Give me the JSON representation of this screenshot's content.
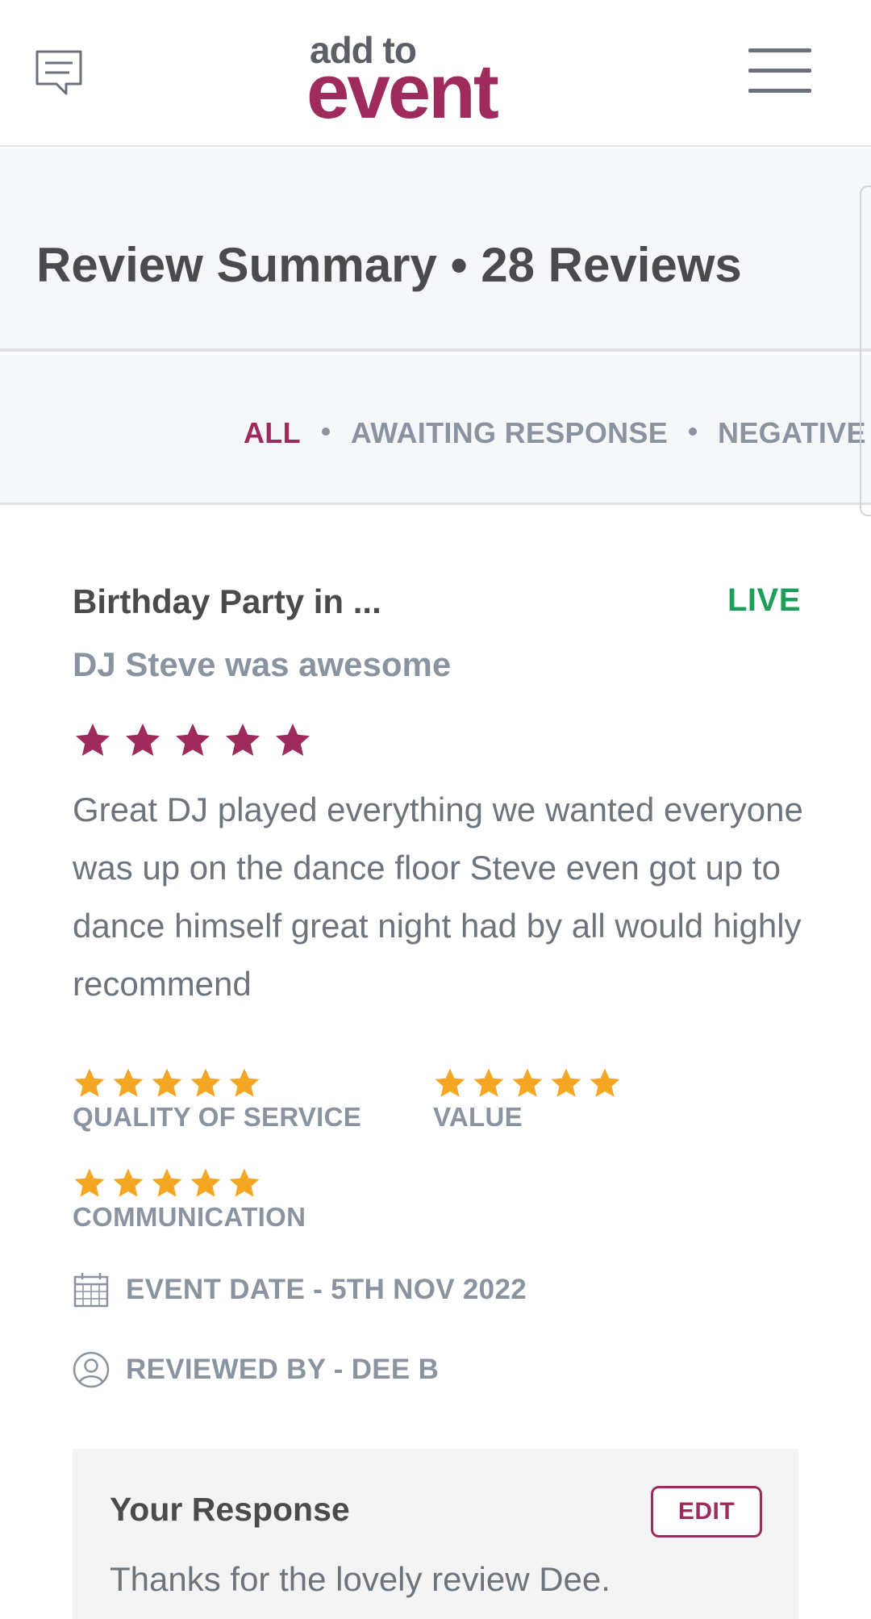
{
  "header": {
    "logo_small": "add to",
    "logo_big": "event",
    "chat_icon": "chat-bubble-icon",
    "menu_icon": "hamburger-menu-icon"
  },
  "summary": {
    "title": "Review Summary • 28 Reviews"
  },
  "filters": {
    "items": [
      {
        "label": "ALL",
        "active": true
      },
      {
        "label": "AWAITING RESPONSE",
        "active": false
      },
      {
        "label": "NEGATIVE",
        "active": false
      }
    ]
  },
  "review": {
    "event": "Birthday Party in ...",
    "status": "LIVE",
    "title": "DJ Steve was awesome",
    "rating": 5,
    "body": "Great DJ played everything we wanted everyone was up on the dance floor Steve even got up to dance himself great night had by all would highly recommend",
    "ratings": [
      {
        "label": "QUALITY OF SERVICE",
        "stars": 5
      },
      {
        "label": "VALUE",
        "stars": 5
      },
      {
        "label": "COMMUNICATION",
        "stars": 5
      }
    ],
    "event_date": "EVENT DATE - 5TH NOV 2022",
    "reviewed_by": "REVIEWED BY - DEE B"
  },
  "response": {
    "heading": "Your Response",
    "edit_label": "EDIT",
    "text": "Thanks for the lovely review Dee."
  },
  "colors": {
    "brand": "#9e2b5c",
    "live": "#1e9e5a",
    "star_orange": "#f5a623",
    "muted": "#8a93a0"
  }
}
